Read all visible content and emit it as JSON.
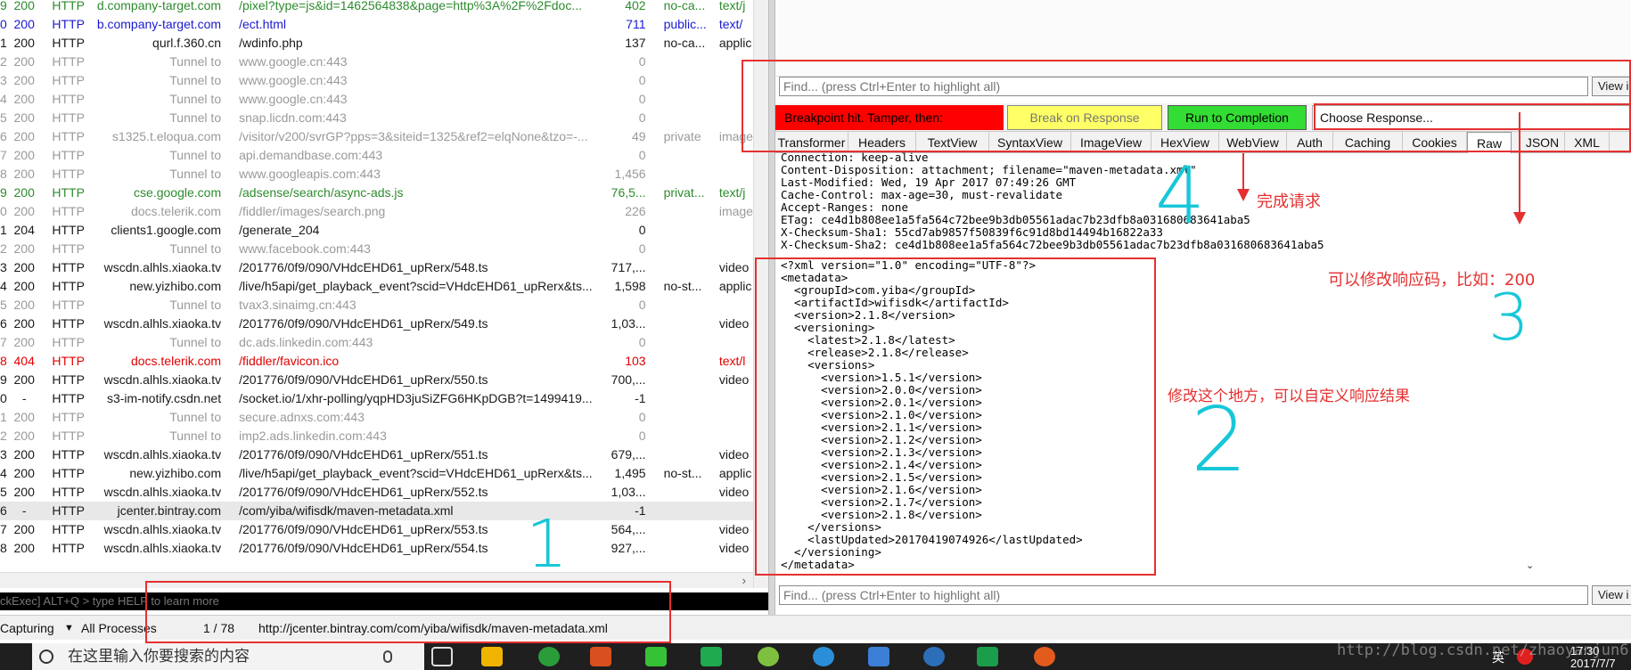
{
  "sessions": [
    {
      "id": "9",
      "result": "200",
      "protocol": "HTTP",
      "host": "d.company-target.com",
      "url": "/pixel?type=js&id=1462564838&page=http%3A%2F%2Fdoc...",
      "body": "402",
      "caching": "no-ca...",
      "ctype": "text/j",
      "style": "green"
    },
    {
      "id": "0",
      "result": "200",
      "protocol": "HTTP",
      "host": "b.company-target.com",
      "url": "/ect.html",
      "body": "711",
      "caching": "public...",
      "ctype": "text/",
      "style": "blue"
    },
    {
      "id": "1",
      "result": "200",
      "protocol": "HTTP",
      "host": "qurl.f.360.cn",
      "url": "/wdinfo.php",
      "body": "137",
      "caching": "no-ca...",
      "ctype": "applic",
      "style": "normal"
    },
    {
      "id": "2",
      "result": "200",
      "protocol": "HTTP",
      "host": "Tunnel to",
      "url": "www.google.cn:443",
      "body": "0",
      "caching": "",
      "ctype": "",
      "style": "tunnel"
    },
    {
      "id": "3",
      "result": "200",
      "protocol": "HTTP",
      "host": "Tunnel to",
      "url": "www.google.cn:443",
      "body": "0",
      "caching": "",
      "ctype": "",
      "style": "tunnel"
    },
    {
      "id": "4",
      "result": "200",
      "protocol": "HTTP",
      "host": "Tunnel to",
      "url": "www.google.cn:443",
      "body": "0",
      "caching": "",
      "ctype": "",
      "style": "tunnel"
    },
    {
      "id": "5",
      "result": "200",
      "protocol": "HTTP",
      "host": "Tunnel to",
      "url": "snap.licdn.com:443",
      "body": "0",
      "caching": "",
      "ctype": "",
      "style": "tunnel"
    },
    {
      "id": "6",
      "result": "200",
      "protocol": "HTTP",
      "host": "s1325.t.eloqua.com",
      "url": "/visitor/v200/svrGP?pps=3&siteid=1325&ref2=elqNone&tzo=-...",
      "body": "49",
      "caching": "private",
      "ctype": "image",
      "style": "tunnel"
    },
    {
      "id": "7",
      "result": "200",
      "protocol": "HTTP",
      "host": "Tunnel to",
      "url": "api.demandbase.com:443",
      "body": "0",
      "caching": "",
      "ctype": "",
      "style": "tunnel"
    },
    {
      "id": "8",
      "result": "200",
      "protocol": "HTTP",
      "host": "Tunnel to",
      "url": "www.googleapis.com:443",
      "body": "1,456",
      "caching": "",
      "ctype": "",
      "style": "tunnel"
    },
    {
      "id": "9",
      "result": "200",
      "protocol": "HTTP",
      "host": "cse.google.com",
      "url": "/adsense/search/async-ads.js",
      "body": "76,5...",
      "caching": "privat...",
      "ctype": "text/j",
      "style": "green"
    },
    {
      "id": "0",
      "result": "200",
      "protocol": "HTTP",
      "host": "docs.telerik.com",
      "url": "/fiddler/images/search.png",
      "body": "226",
      "caching": "",
      "ctype": "image",
      "style": "tunnel"
    },
    {
      "id": "1",
      "result": "204",
      "protocol": "HTTP",
      "host": "clients1.google.com",
      "url": "/generate_204",
      "body": "0",
      "caching": "",
      "ctype": "",
      "style": "normal"
    },
    {
      "id": "2",
      "result": "200",
      "protocol": "HTTP",
      "host": "Tunnel to",
      "url": "www.facebook.com:443",
      "body": "0",
      "caching": "",
      "ctype": "",
      "style": "tunnel"
    },
    {
      "id": "3",
      "result": "200",
      "protocol": "HTTP",
      "host": "wscdn.alhls.xiaoka.tv",
      "url": "/201776/0f9/090/VHdcEHD61_upRerx/548.ts",
      "body": "717,...",
      "caching": "",
      "ctype": "video",
      "style": "normal"
    },
    {
      "id": "4",
      "result": "200",
      "protocol": "HTTP",
      "host": "new.yizhibo.com",
      "url": "/live/h5api/get_playback_event?scid=VHdcEHD61_upRerx&ts...",
      "body": "1,598",
      "caching": "no-st...",
      "ctype": "applic",
      "style": "normal"
    },
    {
      "id": "5",
      "result": "200",
      "protocol": "HTTP",
      "host": "Tunnel to",
      "url": "tvax3.sinaimg.cn:443",
      "body": "0",
      "caching": "",
      "ctype": "",
      "style": "tunnel"
    },
    {
      "id": "6",
      "result": "200",
      "protocol": "HTTP",
      "host": "wscdn.alhls.xiaoka.tv",
      "url": "/201776/0f9/090/VHdcEHD61_upRerx/549.ts",
      "body": "1,03...",
      "caching": "",
      "ctype": "video",
      "style": "normal"
    },
    {
      "id": "7",
      "result": "200",
      "protocol": "HTTP",
      "host": "Tunnel to",
      "url": "dc.ads.linkedin.com:443",
      "body": "0",
      "caching": "",
      "ctype": "",
      "style": "tunnel"
    },
    {
      "id": "8",
      "result": "404",
      "protocol": "HTTP",
      "host": "docs.telerik.com",
      "url": "/fiddler/favicon.ico",
      "body": "103",
      "caching": "",
      "ctype": "text/l",
      "style": "red"
    },
    {
      "id": "9",
      "result": "200",
      "protocol": "HTTP",
      "host": "wscdn.alhls.xiaoka.tv",
      "url": "/201776/0f9/090/VHdcEHD61_upRerx/550.ts",
      "body": "700,...",
      "caching": "",
      "ctype": "video",
      "style": "normal"
    },
    {
      "id": "0",
      "result": "-",
      "protocol": "HTTP",
      "host": "s3-im-notify.csdn.net",
      "url": "/socket.io/1/xhr-polling/yqpHD3juSiZFG6HKpDGB?t=1499419...",
      "body": "-1",
      "caching": "",
      "ctype": "",
      "style": "normal"
    },
    {
      "id": "1",
      "result": "200",
      "protocol": "HTTP",
      "host": "Tunnel to",
      "url": "secure.adnxs.com:443",
      "body": "0",
      "caching": "",
      "ctype": "",
      "style": "tunnel"
    },
    {
      "id": "2",
      "result": "200",
      "protocol": "HTTP",
      "host": "Tunnel to",
      "url": "imp2.ads.linkedin.com:443",
      "body": "0",
      "caching": "",
      "ctype": "",
      "style": "tunnel"
    },
    {
      "id": "3",
      "result": "200",
      "protocol": "HTTP",
      "host": "wscdn.alhls.xiaoka.tv",
      "url": "/201776/0f9/090/VHdcEHD61_upRerx/551.ts",
      "body": "679,...",
      "caching": "",
      "ctype": "video",
      "style": "normal"
    },
    {
      "id": "4",
      "result": "200",
      "protocol": "HTTP",
      "host": "new.yizhibo.com",
      "url": "/live/h5api/get_playback_event?scid=VHdcEHD61_upRerx&ts...",
      "body": "1,495",
      "caching": "no-st...",
      "ctype": "applic",
      "style": "normal"
    },
    {
      "id": "5",
      "result": "200",
      "protocol": "HTTP",
      "host": "wscdn.alhls.xiaoka.tv",
      "url": "/201776/0f9/090/VHdcEHD61_upRerx/552.ts",
      "body": "1,03...",
      "caching": "",
      "ctype": "video",
      "style": "normal"
    },
    {
      "id": "6",
      "result": "-",
      "protocol": "HTTP",
      "host": "jcenter.bintray.com",
      "url": "/com/yiba/wifisdk/maven-metadata.xml",
      "body": "-1",
      "caching": "",
      "ctype": "",
      "style": "selected"
    },
    {
      "id": "7",
      "result": "200",
      "protocol": "HTTP",
      "host": "wscdn.alhls.xiaoka.tv",
      "url": "/201776/0f9/090/VHdcEHD61_upRerx/553.ts",
      "body": "564,...",
      "caching": "",
      "ctype": "video",
      "style": "normal"
    },
    {
      "id": "8",
      "result": "200",
      "protocol": "HTTP",
      "host": "wscdn.alhls.xiaoka.tv",
      "url": "/201776/0f9/090/VHdcEHD61_upRerx/554.ts",
      "body": "927,...",
      "caching": "",
      "ctype": "video",
      "style": "normal"
    }
  ],
  "quickexec_hint": "ckExec] ALT+Q > type HELP to learn more",
  "find_placeholder": "Find... (press Ctrl+Enter to highlight all)",
  "view_button": "View i",
  "breakpoint": {
    "label": "Breakpoint hit. Tamper, then:",
    "break_on_response": "Break on Response",
    "run_to_completion": "Run to Completion",
    "choose_response": "Choose Response..."
  },
  "tabs": [
    "Transformer",
    "Headers",
    "TextView",
    "SyntaxView",
    "ImageView",
    "HexView",
    "WebView",
    "Auth",
    "Caching",
    "Cookies",
    "Raw",
    "JSON",
    "XML"
  ],
  "active_tab": "Raw",
  "response_headers": "Connection: keep-alive\nContent-Disposition: attachment; filename=\"maven-metadata.xml\"\nLast-Modified: Wed, 19 Apr 2017 07:49:26 GMT\nCache-Control: max-age=30, must-revalidate\nAccept-Ranges: none\nETag: ce4d1b808ee1a5fa564c72bee9b3db05561adac7b23dfb8a031680683641aba5\nX-Checksum-Sha1: 55cd7ab9857f50839f6c91d8bd14494b16822a33\nX-Checksum-Sha2: ce4d1b808ee1a5fa564c72bee9b3db05561adac7b23dfb8a031680683641aba5",
  "response_body": "<?xml version=\"1.0\" encoding=\"UTF-8\"?>\n<metadata>\n  <groupId>com.yiba</groupId>\n  <artifactId>wifisdk</artifactId>\n  <version>2.1.8</version>\n  <versioning>\n    <latest>2.1.8</latest>\n    <release>2.1.8</release>\n    <versions>\n      <version>1.5.1</version>\n      <version>2.0.0</version>\n      <version>2.0.1</version>\n      <version>2.1.0</version>\n      <version>2.1.1</version>\n      <version>2.1.2</version>\n      <version>2.1.3</version>\n      <version>2.1.4</version>\n      <version>2.1.5</version>\n      <version>2.1.6</version>\n      <version>2.1.7</version>\n      <version>2.1.8</version>\n    </versions>\n    <lastUpdated>20170419074926</lastUpdated>\n  </versioning>\n</metadata>",
  "statusbar": {
    "capturing": "Capturing",
    "processes": "All Processes",
    "count": "1 / 78",
    "url": "http://jcenter.bintray.com/com/yiba/wifisdk/maven-metadata.xml"
  },
  "taskbar": {
    "search_placeholder": "在这里输入你要搜索的内容",
    "ime": "英",
    "time": "17:30",
    "date": "2017/7/7"
  },
  "annotations": {
    "num1": "1",
    "num2": "2",
    "num3": "3",
    "num4": "4",
    "note_complete": "完成请求",
    "note_modify_code": "可以修改响应码，比如：200",
    "note_modify_body": "修改这个地方，可以自定义响应结果"
  },
  "watermark": "http://blog.csdn.net/zhaoyanjun6",
  "colors": {
    "breakpoint_red": "#ff0000",
    "break_on_response_yellow": "#ffff66",
    "run_to_completion_green": "#33dd33",
    "annotation_red": "#e53030",
    "annotation_cyan": "#17c7d8"
  }
}
